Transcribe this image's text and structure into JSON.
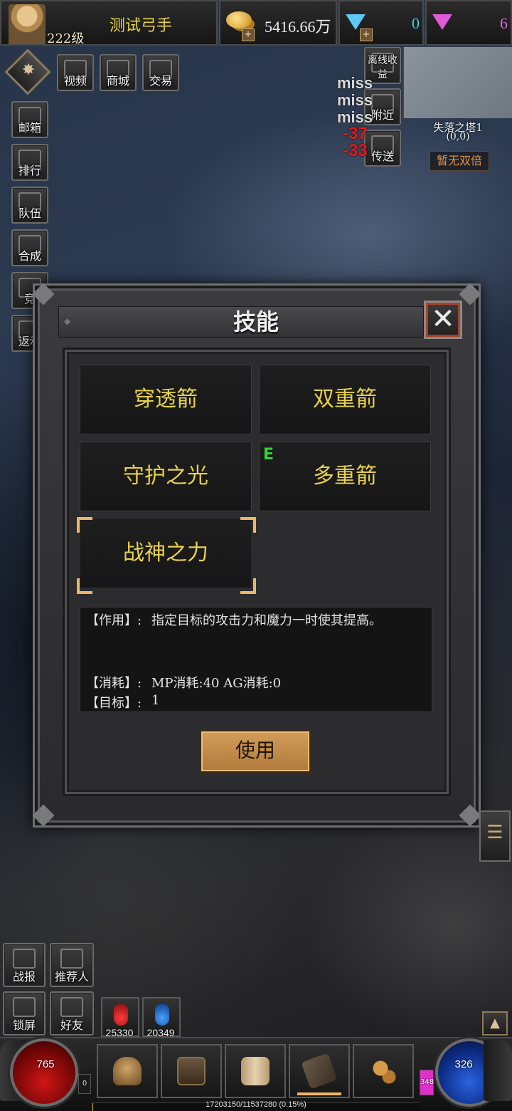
{
  "player": {
    "name": "测试弓手",
    "level": "222级"
  },
  "currency": {
    "gold": "5416.66万",
    "diamond_blue": "0",
    "diamond_pink": "6"
  },
  "top_menu": [
    {
      "label": "视频"
    },
    {
      "label": "商城"
    },
    {
      "label": "交易"
    }
  ],
  "left_menu": [
    {
      "label": "邮箱"
    },
    {
      "label": "排行"
    },
    {
      "label": "队伍"
    },
    {
      "label": "合成"
    },
    {
      "label": "竞"
    },
    {
      "label": "返利"
    }
  ],
  "right_actions": [
    {
      "label": "离线收益"
    },
    {
      "label": "附近"
    },
    {
      "label": "传送"
    }
  ],
  "combat_text": {
    "miss": [
      "miss",
      "miss",
      "miss"
    ],
    "damage": [
      "-37",
      "-33"
    ]
  },
  "minimap": {
    "location": "失落之塔1",
    "coords": "(0,0)",
    "double_status": "暂无双倍"
  },
  "skill_panel": {
    "title": "技能",
    "close_glyph": "✕",
    "skills": [
      {
        "name": "穿透箭"
      },
      {
        "name": "双重箭"
      },
      {
        "name": "守护之光"
      },
      {
        "name": "多重箭",
        "key": "E"
      },
      {
        "name": "战神之力",
        "selected": true
      }
    ],
    "description": {
      "effect_label": "【作用】:",
      "effect_text": "指定目标的攻击力和魔力一时使其提高。",
      "cost_label": "【消耗】:",
      "cost_text": "MP消耗:40   AG消耗:0",
      "target_label": "【目标】:",
      "target_text": "1"
    },
    "use_button": "使用"
  },
  "bottom_left": [
    {
      "label": "战报"
    },
    {
      "label": "推荐人"
    },
    {
      "label": "锁屏"
    },
    {
      "label": "好友"
    }
  ],
  "potions": {
    "hp": "25330",
    "mp": "20349"
  },
  "orbs": {
    "hp": "765",
    "mp": "326",
    "left_small": "0",
    "right_small": "348"
  },
  "exp_text": "17203150/11537280 (0.15%)",
  "colors": {
    "skill_name": "#e8d24a",
    "use_button": "#c88c48",
    "selection": "#f0b663",
    "key_badge": "#38d23a"
  }
}
